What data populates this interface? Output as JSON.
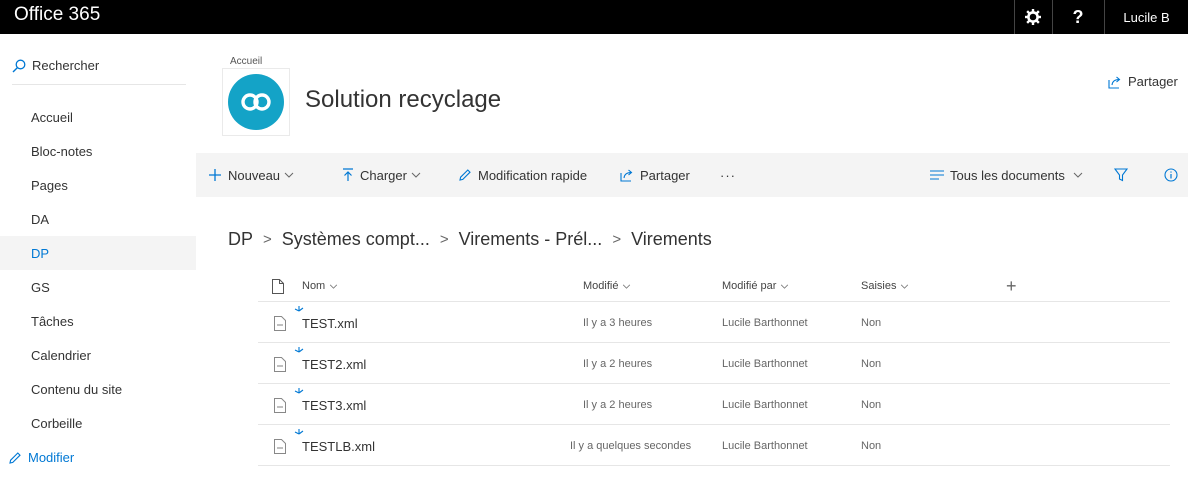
{
  "topbar": {
    "app_title": "Office 365",
    "settings_icon": "gear-icon",
    "help_label": "?",
    "user_name": "Lucile B"
  },
  "sidebar": {
    "search_label": "Rechercher",
    "items": [
      {
        "label": "Accueil"
      },
      {
        "label": "Bloc-notes"
      },
      {
        "label": "Pages"
      },
      {
        "label": "DA"
      },
      {
        "label": "DP",
        "active": true
      },
      {
        "label": "GS"
      },
      {
        "label": "Tâches"
      },
      {
        "label": "Calendrier"
      },
      {
        "label": "Contenu du site"
      },
      {
        "label": "Corbeille"
      }
    ],
    "edit_label": "Modifier"
  },
  "site": {
    "breadcrumb": "Accueil",
    "title": "Solution recyclage",
    "share_label": "Partager",
    "logo_color": "#14a3c7"
  },
  "commands": {
    "new_label": "Nouveau",
    "upload_label": "Charger",
    "quick_edit_label": "Modification rapide",
    "share_label": "Partager",
    "more_label": "···",
    "view_label": "Tous les documents"
  },
  "path": {
    "segments": [
      "DP",
      "Systèmes compt...",
      "Virements - Prél...",
      "Virements"
    ],
    "separator": ">"
  },
  "list": {
    "columns": {
      "name": "Nom",
      "modified": "Modifié",
      "modified_by": "Modifié par",
      "saisies": "Saisies",
      "add": "+"
    },
    "rows": [
      {
        "name": "TEST.xml",
        "modified": "Il y a 3 heures",
        "modified_by": "Lucile Barthonnet",
        "saisies": "Non"
      },
      {
        "name": "TEST2.xml",
        "modified": "Il y a 2 heures",
        "modified_by": "Lucile Barthonnet",
        "saisies": "Non"
      },
      {
        "name": "TEST3.xml",
        "modified": "Il y a 2 heures",
        "modified_by": "Lucile Barthonnet",
        "saisies": "Non"
      },
      {
        "name": "TESTLB.xml",
        "modified": "Il y a quelques secondes",
        "modified_by": "Lucile Barthonnet",
        "saisies": "Non"
      }
    ]
  },
  "colors": {
    "accent": "#0078d4",
    "topbar": "#000000",
    "commandbar": "#f4f4f4"
  }
}
